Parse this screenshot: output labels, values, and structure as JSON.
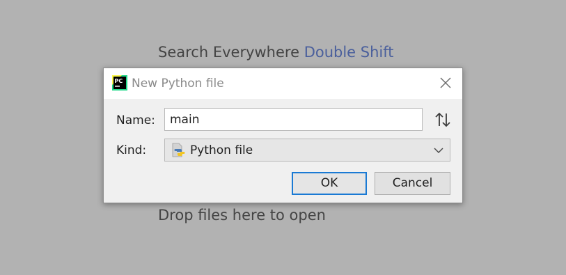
{
  "background_hints": {
    "search_prefix": "Search Everywhere",
    "search_shortcut": "Double Shift",
    "drop_files": "Drop files here to open"
  },
  "dialog": {
    "title": "New Python file",
    "app_logo_text": "PC",
    "name_label": "Name:",
    "name_value": "main",
    "kind_label": "Kind:",
    "kind_value": "Python file",
    "ok_label": "OK",
    "cancel_label": "Cancel"
  },
  "icons": {
    "app_logo": "pycharm-logo-icon",
    "close": "close-icon",
    "sort": "sort-arrows-icon",
    "kind": "python-file-icon",
    "dropdown": "chevron-down-icon"
  },
  "colors": {
    "background": "#b2b2b2",
    "shortcut_accent": "#4a5f9c",
    "ok_focus_border": "#1a7ad4",
    "dialog_bg": "#f0f0f0",
    "title_bg": "#ffffff"
  }
}
